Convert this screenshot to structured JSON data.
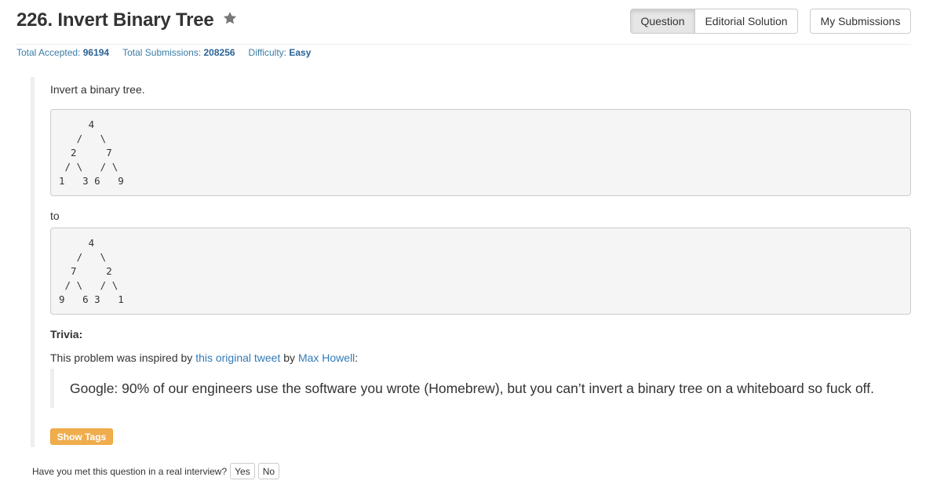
{
  "header": {
    "title": "226. Invert Binary Tree",
    "star_icon": "star-icon",
    "tabs": [
      {
        "label": "Question",
        "active": true
      },
      {
        "label": "Editorial Solution",
        "active": false
      }
    ],
    "my_submissions_label": "My Submissions"
  },
  "stats": {
    "accepted_label": "Total Accepted:",
    "accepted_value": "96194",
    "submissions_label": "Total Submissions:",
    "submissions_value": "208256",
    "difficulty_label": "Difficulty:",
    "difficulty_value": "Easy"
  },
  "problem": {
    "intro": "Invert a binary tree.",
    "tree_before": "     4\n   /   \\\n  2     7\n / \\   / \\\n1   3 6   9",
    "to_label": "to",
    "tree_after": "     4\n   /   \\\n  7     2\n / \\   / \\\n9   6 3   1",
    "trivia_title": "Trivia:",
    "trivia_text_1": "This problem was inspired by ",
    "trivia_link_1": "this original tweet",
    "trivia_text_2": " by ",
    "trivia_link_2": "Max Howell",
    "trivia_text_3": ":",
    "quote": "Google: 90% of our engineers use the software you wrote (Homebrew), but you can’t invert a binary tree on a whiteboard so fuck off.",
    "show_tags_label": "Show Tags"
  },
  "interview": {
    "question": "Have you met this question in a real interview?",
    "yes_label": "Yes",
    "no_label": "No"
  },
  "colors": {
    "accent_link": "#337ab7",
    "tag_button": "#f0ad4e"
  }
}
